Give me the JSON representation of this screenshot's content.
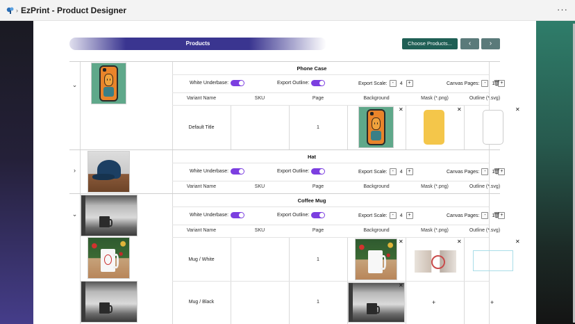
{
  "window": {
    "title": "EzPrint - Product Designer",
    "more_label": "···"
  },
  "toolbar": {
    "products_label": "Products",
    "choose_label": "Choose Products...",
    "prev_label": "‹",
    "next_label": "›"
  },
  "options_labels": {
    "white_underbase": "White Underbase:",
    "export_outline": "Export Outline:",
    "export_scale": "Export Scale:",
    "canvas_pages": "Canvas Pages:",
    "minus": "-",
    "plus": "+"
  },
  "columns": [
    "Variant Name",
    "SKU",
    "Page",
    "Background",
    "Mask (*.png)",
    "Outline (*.svg)"
  ],
  "products": [
    {
      "name": "Phone Case",
      "expanded": true,
      "export_scale": "4",
      "canvas_pages": "1",
      "variants": [
        {
          "name": "Default Title",
          "sku": "",
          "page": "1"
        }
      ]
    },
    {
      "name": "Hat",
      "expanded": false,
      "export_scale": "4",
      "canvas_pages": "1",
      "variants": []
    },
    {
      "name": "Coffee Mug",
      "expanded": true,
      "export_scale": "4",
      "canvas_pages": "1",
      "variants": [
        {
          "name": "Mug / White",
          "sku": "",
          "page": "1"
        },
        {
          "name": "Mug / Black",
          "sku": "",
          "page": "1"
        }
      ]
    }
  ],
  "glyphs": {
    "expanded": "⌄",
    "collapsed": "›",
    "close": "✕",
    "add": "+",
    "trash": "🗑"
  },
  "colors": {
    "toggle_on": "#7c3fe0",
    "choose_button": "#1f5f55",
    "banner": "#3a3590"
  }
}
